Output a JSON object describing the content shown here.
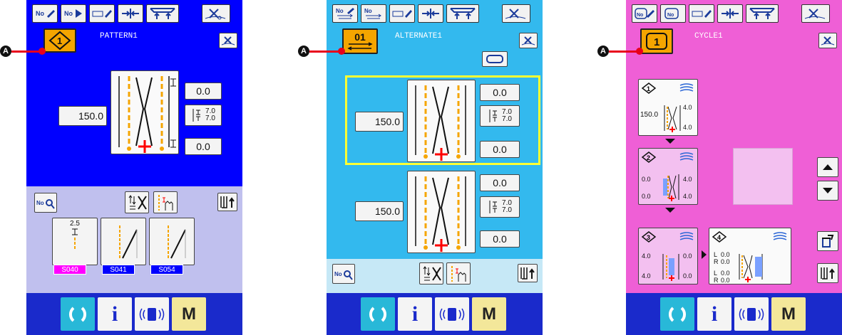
{
  "callout_letter": "A",
  "screens": [
    {
      "name": "pattern",
      "title": "PATTERN1",
      "bg": "#0000ff",
      "lower_bg": "#c0c0ee",
      "sel_icon": "pattern-number-icon",
      "length": "150.0",
      "top_value": "0.0",
      "bottom_value": "0.0",
      "pitch_top": "7.0",
      "pitch_bottom": "7.0",
      "patterns": [
        {
          "value": "2.5",
          "code": "S040",
          "code_color": "#ff00ff"
        },
        {
          "code": "S041",
          "code_color": "#0000ff"
        },
        {
          "code": "S054",
          "code_color": "#0000ff"
        }
      ]
    },
    {
      "name": "alternate",
      "title": "ALTERNATE1",
      "bg": "#33b9ee",
      "lower_bg": "#c6e8f6",
      "sel_number": "01",
      "length_1": "150.0",
      "top_value_1": "0.0",
      "bottom_value_1": "0.0",
      "pitch_top_1": "7.0",
      "pitch_bottom_1": "7.0",
      "length_2": "150.0",
      "top_value_2": "0.0",
      "bottom_value_2": "0.0",
      "pitch_top_2": "7.0",
      "pitch_bottom_2": "7.0"
    },
    {
      "name": "cycle",
      "title": "CYCLE1",
      "bg": "#ef5fd6",
      "sel_number": "1",
      "steps": [
        {
          "length": "150.0",
          "upper": "4.0",
          "lower": "4.0"
        },
        {
          "left_top": "0.0",
          "left_bottom": "0.0",
          "upper": "4.0",
          "lower": "4.0"
        },
        {
          "left_top": "4.0",
          "left_bottom": "4.0",
          "upper": "0.0",
          "lower": "0.0"
        },
        {
          "l_label": "L",
          "r_label": "R",
          "l_value": "0.0",
          "r_value": "0.0",
          "l2_label": "L",
          "r2_label": "R",
          "l2_value": "0.0",
          "r2_value": "0.0"
        }
      ]
    }
  ],
  "colors": {
    "accent_orange": "#f5a500",
    "yellow_frame": "#ffff33",
    "red_mark": "#ff0000",
    "bottom_bar": "#1a2acb",
    "ready_btn": "#28b8d8",
    "m_btn": "#f3e79a"
  },
  "bottom_labels": {
    "info": "i",
    "mode": "M"
  }
}
